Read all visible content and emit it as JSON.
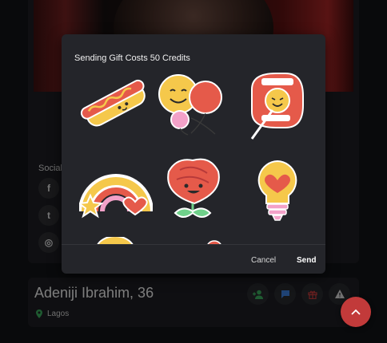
{
  "modal": {
    "title": "Sending Gift Costs 50 Credits",
    "cancel_label": "Cancel",
    "send_label": "Send"
  },
  "gifts": [
    {
      "icon": "hotdog-icon"
    },
    {
      "icon": "smiley-balloons-icon"
    },
    {
      "icon": "mouth-lollipop-icon"
    },
    {
      "icon": "rainbow-heart-icon"
    },
    {
      "icon": "rose-icon"
    },
    {
      "icon": "lightbulb-heart-icon"
    }
  ],
  "social": {
    "label": "Social",
    "links": [
      {
        "icon": "facebook-icon",
        "glyph": "f"
      },
      {
        "icon": "twitter-icon",
        "glyph": "t"
      },
      {
        "icon": "instagram-icon",
        "glyph": "◎"
      }
    ]
  },
  "profile": {
    "name": "Adeniji Ibrahim, 36",
    "location": "Lagos"
  },
  "colors": {
    "accent": "#c23a3a",
    "online_green": "#3aa65a",
    "chat_blue": "#3a7bd5"
  }
}
